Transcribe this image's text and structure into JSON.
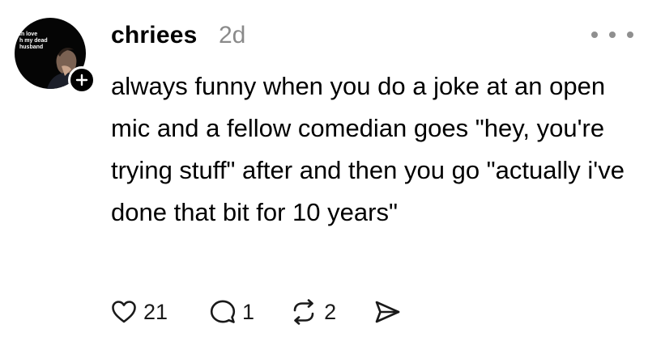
{
  "post": {
    "avatar_caption": "in love\nh my dead\nhusband",
    "username": "chriees",
    "timestamp": "2d",
    "text": "always funny when you do a joke at an open mic and a fellow comedian goes \"hey, you're trying stuff\" after and then you go \"actually i've done that bit for 10 years\"",
    "follow_icon": "plus-icon",
    "more_icon": "more-icon"
  },
  "actions": {
    "like": {
      "icon": "heart-icon",
      "count": "21"
    },
    "reply": {
      "icon": "comment-icon",
      "count": "1"
    },
    "repost": {
      "icon": "repost-icon",
      "count": "2"
    },
    "share": {
      "icon": "send-icon"
    }
  }
}
